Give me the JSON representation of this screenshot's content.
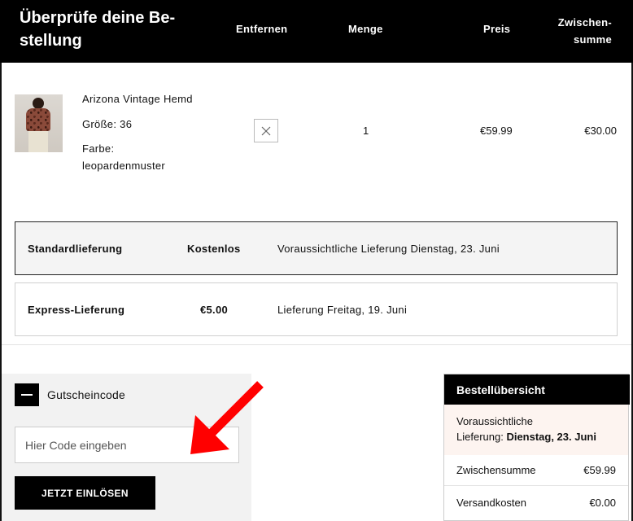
{
  "header": {
    "title": "Überprüfe deine Be- stellung",
    "col_remove": "Entfernen",
    "col_qty": "Menge",
    "col_price": "Preis",
    "col_subtotal_line1": "Zwischen-",
    "col_subtotal_line2": "summe"
  },
  "product": {
    "name": "Arizona Vintage Hemd",
    "size": "Größe: 36",
    "color_label": "Farbe:",
    "color_value": "leopardenmuster",
    "quantity": "1",
    "price": "€59.99",
    "subtotal": "€30.00",
    "remove_icon": "close-icon"
  },
  "shipping": {
    "standard": {
      "name": "Standardlieferung",
      "cost": "Kostenlos",
      "eta": "Voraussichtliche Lieferung Dienstag, 23. Juni",
      "selected": true
    },
    "express": {
      "name": "Express-Lieferung",
      "cost": "€5.00",
      "eta": "Lieferung Freitag, 19. Juni",
      "selected": false
    }
  },
  "coupon": {
    "label": "Gutscheincode",
    "toggle_icon": "minus-icon",
    "placeholder": "Hier Code eingeben",
    "value": "",
    "button_label": "JETZT EINLÖSEN"
  },
  "annotation": {
    "arrow_icon": "red-arrow-icon",
    "arrow_color": "#ff0000"
  },
  "summary": {
    "title": "Bestellübersicht",
    "eta_line1": "Voraussichtliche",
    "eta_prefix": "Lieferung: ",
    "eta_date": "Dienstag, 23. Juni",
    "subtotal_label": "Zwischensumme",
    "subtotal_value": "€59.99",
    "shipping_label": "Versandkosten",
    "shipping_value": "€0.00"
  },
  "colors": {
    "header_bg": "#000000",
    "accent_text": "#ffffff",
    "summary_eta_bg": "#fdf4f0"
  }
}
